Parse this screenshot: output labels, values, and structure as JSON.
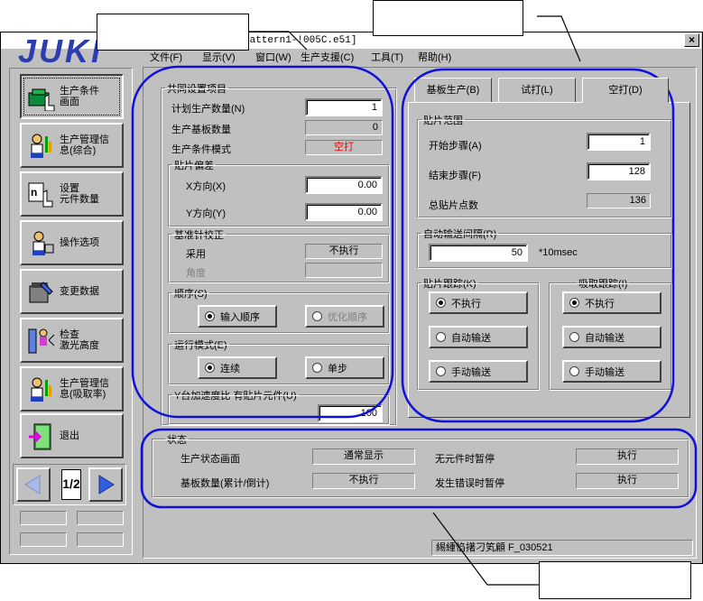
{
  "window": {
    "title": "Pattern1-!005C.e51]",
    "close": "×"
  },
  "logo_text": "JUKI",
  "menu": [
    "文件(F)",
    "显示(V)",
    "窗口(W)",
    "生产支援(C)",
    "工具(T)",
    "帮助(H)"
  ],
  "nav": [
    {
      "label": "生产条件\n画面",
      "icon": "production-conditions-icon",
      "active": true
    },
    {
      "label": "生产管理信\n息(综合)",
      "icon": "operator-info-icon"
    },
    {
      "label": "设置\n元件数量",
      "icon": "component-count-icon"
    },
    {
      "label": "操作选项",
      "icon": "operator-option-icon"
    },
    {
      "label": "变更数据",
      "icon": "edit-data-icon"
    },
    {
      "label": "检查\n激光高度",
      "icon": "laser-height-icon"
    },
    {
      "label": "生产管理信\n息(吸取率)",
      "icon": "operator-pickup-icon"
    },
    {
      "label": "退出",
      "icon": "exit-door-icon"
    }
  ],
  "pager": {
    "page": "1/2"
  },
  "common": {
    "title": "共同设置项目",
    "plan_qty_label": "计划生产数量(N)",
    "plan_qty": "1",
    "board_count_label": "生产基板数量",
    "board_count": "0",
    "mode_label": "生产条件模式",
    "mode_value": "空打",
    "offset_title": "贴片偏差",
    "x_label": "X方向(X)",
    "x_value": "0.00",
    "y_label": "Y方向(Y)",
    "y_value": "0.00",
    "ref_title": "基准针校正",
    "adopt_label": "采用",
    "adopt_value": "不执行",
    "angle_label": "角度",
    "angle_value": "",
    "order_title": "顺序(S)",
    "order_input": "输入顺序",
    "order_optimize": "优化顺序",
    "run_title": "运行模式(E)",
    "run_continuous": "连续",
    "run_step": "单步",
    "accel_title": "Y台加速度比 有贴片元件(U)",
    "accel_value": "100"
  },
  "tabs": [
    {
      "label": "基板生产(B)",
      "active": false
    },
    {
      "label": "试打(L)",
      "active": false
    },
    {
      "label": "空打(D)",
      "active": true
    }
  ],
  "range": {
    "title": "贴片范围",
    "start_label": "开始步骤(A)",
    "start": "1",
    "end_label": "结束步骤(F)",
    "end": "128",
    "total_label": "总贴片点数",
    "total": "136"
  },
  "interval": {
    "title": "自动输送间隔(R)",
    "value": "50",
    "unit": "*10msec"
  },
  "place_track": {
    "title": "贴片跟踪(K)",
    "options": [
      "不执行",
      "自动输送",
      "手动输送"
    ],
    "selected": 0
  },
  "pick_track": {
    "title": "吸取跟踪(I)",
    "options": [
      "不执行",
      "自动输送",
      "手动输送"
    ],
    "selected": 0
  },
  "status": {
    "title": "状态",
    "screen_label": "生产状态画面",
    "screen_value": "通常显示",
    "board_label": "基板数量(累计/倒计)",
    "board_value": "不执行",
    "nocomp_label": "无元件时暂停",
    "nocomp_value": "执行",
    "error_label": "发生错误时暂停",
    "error_value": "执行"
  },
  "statusbar": {
    "text": "緆緟惂擆刁笂顅   F_030521"
  },
  "colors": {
    "annotation": "#1010dd",
    "logo": "#2b3bb0",
    "mode_red": "#ff0000"
  }
}
